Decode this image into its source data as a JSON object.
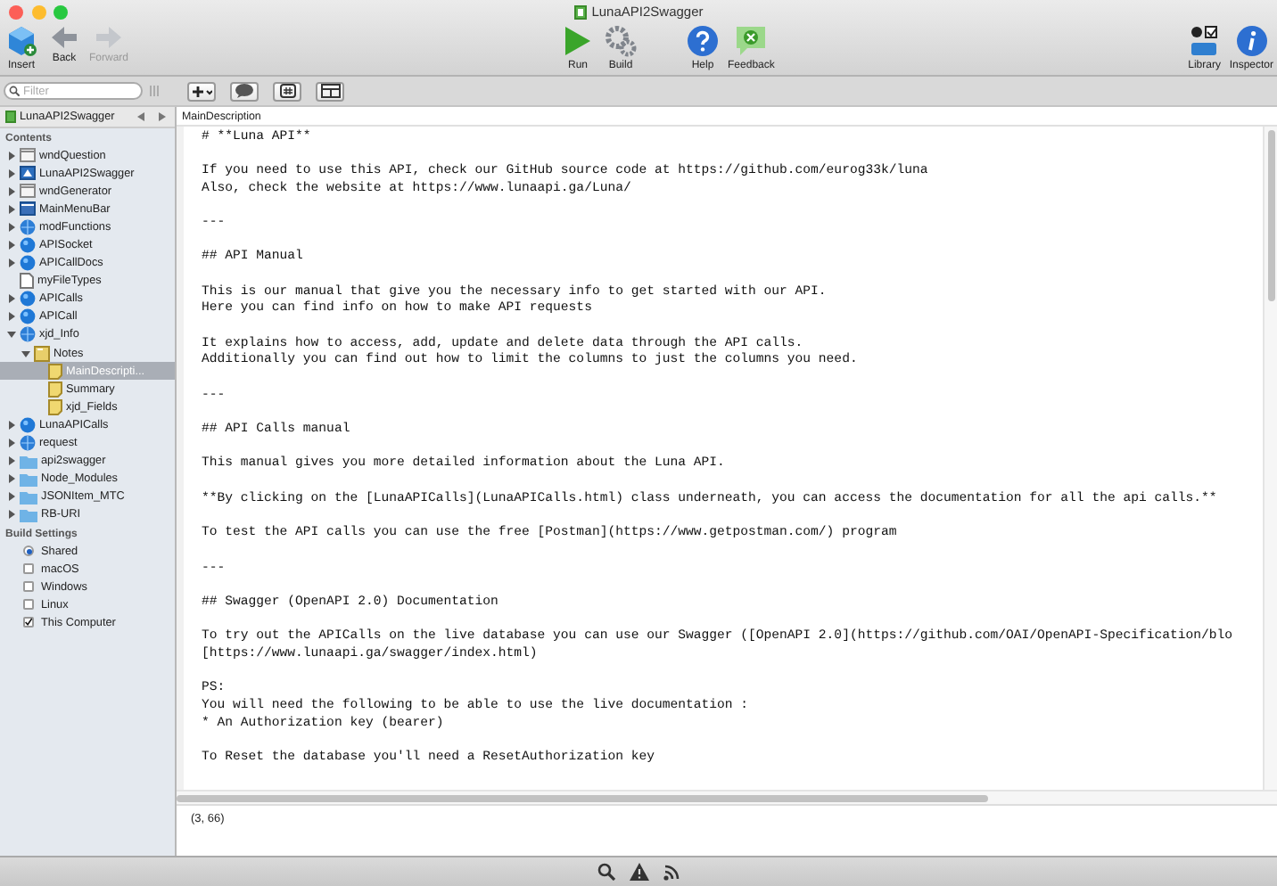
{
  "window": {
    "title": "LunaAPI2Swagger"
  },
  "toolbar": [
    [
      {
        "label": "Insert",
        "kind": "insert",
        "disabled": false
      },
      {
        "label": "Back",
        "kind": "back",
        "disabled": false
      },
      {
        "label": "Forward",
        "kind": "forward",
        "disabled": true
      }
    ],
    [
      {
        "label": "Run",
        "kind": "run",
        "disabled": false
      },
      {
        "label": "Build",
        "kind": "build",
        "disabled": false
      }
    ],
    [
      {
        "label": "Help",
        "kind": "help",
        "disabled": false
      },
      {
        "label": "Feedback",
        "kind": "feedback",
        "disabled": false
      }
    ],
    [
      {
        "label": "Library",
        "kind": "library",
        "disabled": false
      },
      {
        "label": "Inspector",
        "kind": "inspector",
        "disabled": false
      }
    ]
  ],
  "filter": {
    "placeholder": "Filter"
  },
  "editor_buttons": [
    {
      "kind": "add"
    },
    {
      "kind": "comment"
    },
    {
      "kind": "hash"
    },
    {
      "kind": "layout"
    }
  ],
  "sidebar": {
    "project": "LunaAPI2Swagger",
    "contents_heading": "Contents",
    "items": [
      {
        "label": "wndQuestion",
        "kind": "window",
        "expanded": false,
        "selected": false
      },
      {
        "label": "LunaAPI2Swagger",
        "kind": "app",
        "expanded": false,
        "selected": false
      },
      {
        "label": "wndGenerator",
        "kind": "window",
        "expanded": false,
        "selected": false
      },
      {
        "label": "MainMenuBar",
        "kind": "menu",
        "expanded": false,
        "selected": false
      },
      {
        "label": "modFunctions",
        "kind": "module",
        "expanded": false,
        "selected": false
      },
      {
        "label": "APISocket",
        "kind": "class",
        "expanded": false,
        "selected": false
      },
      {
        "label": "APICallDocs",
        "kind": "class",
        "expanded": false,
        "selected": false
      },
      {
        "label": "myFileTypes",
        "kind": "file",
        "selected": false
      },
      {
        "label": "APICalls",
        "kind": "class",
        "expanded": false,
        "selected": false
      },
      {
        "label": "APICall",
        "kind": "class",
        "expanded": false,
        "selected": false
      },
      {
        "label": "xjd_Info",
        "kind": "module",
        "expanded": true,
        "selected": false,
        "children": [
          {
            "label": "Notes",
            "kind": "notes",
            "expanded": true,
            "selected": false,
            "children": [
              {
                "label": "MainDescripti...",
                "kind": "note",
                "selected": true
              },
              {
                "label": "Summary",
                "kind": "note",
                "selected": false
              },
              {
                "label": "xjd_Fields",
                "kind": "note",
                "selected": false
              }
            ]
          }
        ]
      },
      {
        "label": "LunaAPICalls",
        "kind": "class",
        "expanded": false,
        "selected": false
      },
      {
        "label": "request",
        "kind": "module",
        "expanded": false,
        "selected": false
      },
      {
        "label": "api2swagger",
        "kind": "folder",
        "expanded": false,
        "selected": false
      },
      {
        "label": "Node_Modules",
        "kind": "folder",
        "expanded": false,
        "selected": false
      },
      {
        "label": "JSONItem_MTC",
        "kind": "folder",
        "expanded": false,
        "selected": false
      },
      {
        "label": "RB-URI",
        "kind": "folder",
        "expanded": false,
        "selected": false
      }
    ],
    "build_heading": "Build Settings",
    "build_settings": [
      {
        "label": "Shared",
        "kind": "radio",
        "checked": true
      },
      {
        "label": "macOS",
        "kind": "checkbox",
        "checked": false
      },
      {
        "label": "Windows",
        "kind": "checkbox",
        "checked": false
      },
      {
        "label": "Linux",
        "kind": "checkbox",
        "checked": false
      },
      {
        "label": "This Computer",
        "kind": "checkbox",
        "checked": true
      }
    ]
  },
  "editor": {
    "tab": "MainDescription",
    "blocks": [
      {
        "lines": [
          "# **Luna API**"
        ],
        "extra_space": false
      },
      {
        "lines": [
          "If you need to use this API, check our GitHub source code at https://github.com/eurog33k/luna",
          "Also, check the website at https://www.lunaapi.ga/Luna/"
        ],
        "extra_space": false
      },
      {
        "lines": [
          "---"
        ],
        "extra_space": false
      },
      {
        "lines": [
          "## API Manual"
        ],
        "extra_space": false
      },
      {
        "lines": [
          "This is our manual that give you the necessary info to get started with our API.",
          "Here you can find info on how to make API requests"
        ],
        "extra_space": true
      },
      {
        "lines": [
          "It explains how to access, add, update and delete data through the API calls.",
          "Additionally you can find out how to limit the columns to just the columns you need."
        ],
        "extra_space": false
      },
      {
        "lines": [
          "---"
        ],
        "extra_space": false
      },
      {
        "lines": [
          "## API Calls manual"
        ],
        "extra_space": false
      },
      {
        "lines": [
          "This manual gives you more detailed information about the Luna API."
        ],
        "extra_space": false
      },
      {
        "lines": [
          "**By clicking on the [LunaAPICalls](LunaAPICalls.html) class underneath, you can access the documentation for all the api calls.**"
        ],
        "extra_space": false
      },
      {
        "lines": [
          "To test the API calls you can use the free [Postman](https://www.getpostman.com/) program"
        ],
        "extra_space": false
      },
      {
        "lines": [
          "---"
        ],
        "extra_space": false
      },
      {
        "lines": [
          "## Swagger (OpenAPI 2.0) Documentation"
        ],
        "extra_space": false
      },
      {
        "lines": [
          "To try out the APICalls on the live database you can use our Swagger ([OpenAPI 2.0](https://github.com/OAI/OpenAPI-Specification/blo",
          "[https://www.lunaapi.ga/swagger/index.html)"
        ],
        "extra_space": false
      },
      {
        "lines": [
          "PS:",
          "You will need the following to be able to use the live documentation :",
          "* An Authorization key (bearer)"
        ],
        "extra_space": false
      },
      {
        "lines": [
          "To Reset the database you'll need a ResetAuthorization key"
        ],
        "extra_space": false
      }
    ],
    "cursor_position": "(3, 66)"
  },
  "bottom_bar": [
    {
      "kind": "search"
    },
    {
      "kind": "warning"
    },
    {
      "kind": "feed"
    }
  ]
}
